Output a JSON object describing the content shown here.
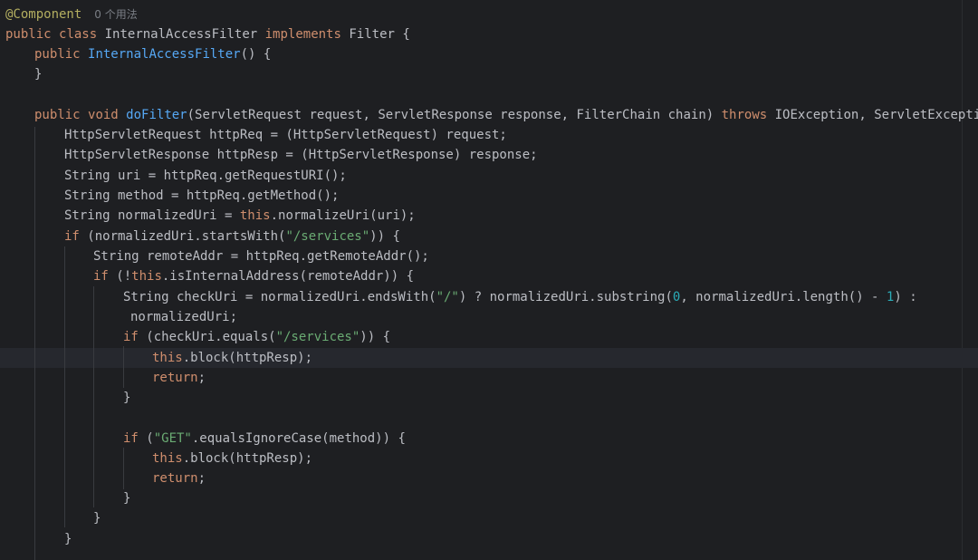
{
  "editor": {
    "annotation": "@Component",
    "usage_hint": "0 个用法",
    "tokens": {
      "public": "public",
      "class": "class",
      "implements": "implements",
      "void": "void",
      "throws": "throws",
      "if": "if",
      "this": "this",
      "return": "return"
    },
    "class_name": "InternalAccessFilter",
    "iface": "Filter",
    "ctor_name": "InternalAccessFilter",
    "method_name": "doFilter",
    "lines": {
      "l2_open": " {",
      "l3_rest": "() {",
      "l4": "}",
      "l6_params": "(ServletRequest request, ServletResponse response, FilterChain chain) ",
      "l6_exc": " IOException, ServletException {",
      "l7": "HttpServletRequest httpReq = (HttpServletRequest) request;",
      "l8": "HttpServletResponse httpResp = (HttpServletResponse) response;",
      "l9": "String uri = httpReq.getRequestURI();",
      "l10": "String method = httpReq.getMethod();",
      "l11_a": "String normalizedUri = ",
      "l11_b": ".normalizeUri(uri);",
      "l12_a": " (normalizedUri.startsWith(",
      "l12_str": "\"/services\"",
      "l12_b": ")) {",
      "l13": "String remoteAddr = httpReq.getRemoteAddr();",
      "l14_a": " (!",
      "l14_b": ".isInternalAddress(remoteAddr)) {",
      "l15_a": "String checkUri = normalizedUri.endsWith(",
      "l15_str": "\"/\"",
      "l15_b": ") ? normalizedUri.substring(",
      "l15_n0": "0",
      "l15_c": ", normalizedUri.length() - ",
      "l15_n1": "1",
      "l15_d": ") :",
      "l16": "normalizedUri;",
      "l17_a": " (checkUri.equals(",
      "l17_str": "\"/services\"",
      "l17_b": ")) {",
      "l18_b": ".block(httpResp);",
      "l19_b": ";",
      "l20": "}",
      "l22_a": " (",
      "l22_str": "\"GET\"",
      "l22_b": ".equalsIgnoreCase(method)) {",
      "l23_b": ".block(httpResp);",
      "l24_b": ";",
      "l25": "}",
      "l26": "}",
      "l27": "}"
    }
  },
  "colors": {
    "background": "#1e1f22",
    "keyword": "#cf8e6d",
    "annotation": "#b3ae60",
    "function": "#56a8f5",
    "string": "#6aab73",
    "number": "#2aacb8",
    "text": "#bcbec4"
  }
}
